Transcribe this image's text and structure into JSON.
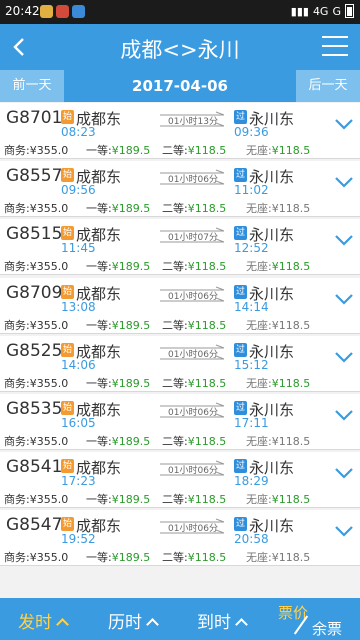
{
  "statusbar": {
    "time": "20:42",
    "signal": "4G",
    "carrier": "G"
  },
  "header": {
    "title": "成都<>永川"
  },
  "datebar": {
    "prev": "前一天",
    "date": "2017-04-06",
    "next": "后一天"
  },
  "badges": {
    "origin": "始",
    "pass": "过"
  },
  "seat_labels": {
    "business": "商务:",
    "first": "一等:",
    "second": "二等:",
    "standing": "无座:"
  },
  "trains": [
    {
      "number": "G8701",
      "from": "成都东",
      "dep": "08:23",
      "duration": "01小时13分",
      "to": "永川东",
      "arr": "09:36",
      "business": "¥355.0",
      "first": "¥189.5",
      "second": "¥118.5",
      "standing": "¥118.5"
    },
    {
      "number": "G8557",
      "from": "成都东",
      "dep": "09:56",
      "duration": "01小时06分",
      "to": "永川东",
      "arr": "11:02",
      "business": "¥355.0",
      "first": "¥189.5",
      "second": "¥118.5",
      "standing": "¥118.5"
    },
    {
      "number": "G8515",
      "from": "成都东",
      "dep": "11:45",
      "duration": "01小时07分",
      "to": "永川东",
      "arr": "12:52",
      "business": "¥355.0",
      "first": "¥189.5",
      "second": "¥118.5",
      "standing": "¥118.5"
    },
    {
      "number": "G8709",
      "from": "成都东",
      "dep": "13:08",
      "duration": "01小时06分",
      "to": "永川东",
      "arr": "14:14",
      "business": "¥355.0",
      "first": "¥189.5",
      "second": "¥118.5",
      "standing": "¥118.5"
    },
    {
      "number": "G8525",
      "from": "成都东",
      "dep": "14:06",
      "duration": "01小时06分",
      "to": "永川东",
      "arr": "15:12",
      "business": "¥355.0",
      "first": "¥189.5",
      "second": "¥118.5",
      "standing": "¥118.5"
    },
    {
      "number": "G8535",
      "from": "成都东",
      "dep": "16:05",
      "duration": "01小时06分",
      "to": "永川东",
      "arr": "17:11",
      "business": "¥355.0",
      "first": "¥189.5",
      "second": "¥118.5",
      "standing": "¥118.5"
    },
    {
      "number": "G8541",
      "from": "成都东",
      "dep": "17:23",
      "duration": "01小时06分",
      "to": "永川东",
      "arr": "18:29",
      "business": "¥355.0",
      "first": "¥189.5",
      "second": "¥118.5",
      "standing": "¥118.5"
    },
    {
      "number": "G8547",
      "from": "成都东",
      "dep": "19:52",
      "duration": "01小时06分",
      "to": "永川东",
      "arr": "20:58",
      "business": "¥355.0",
      "first": "¥189.5",
      "second": "¥118.5",
      "standing": "¥118.5"
    }
  ],
  "bottombar": {
    "depart": "发时",
    "duration": "历时",
    "arrive": "到时",
    "price": "票价",
    "remain": "余票"
  },
  "colors": {
    "accent": "#3a9be0",
    "available": "#2a9a2a",
    "sold_out": "#777777",
    "active_sort": "#ffd24a"
  }
}
